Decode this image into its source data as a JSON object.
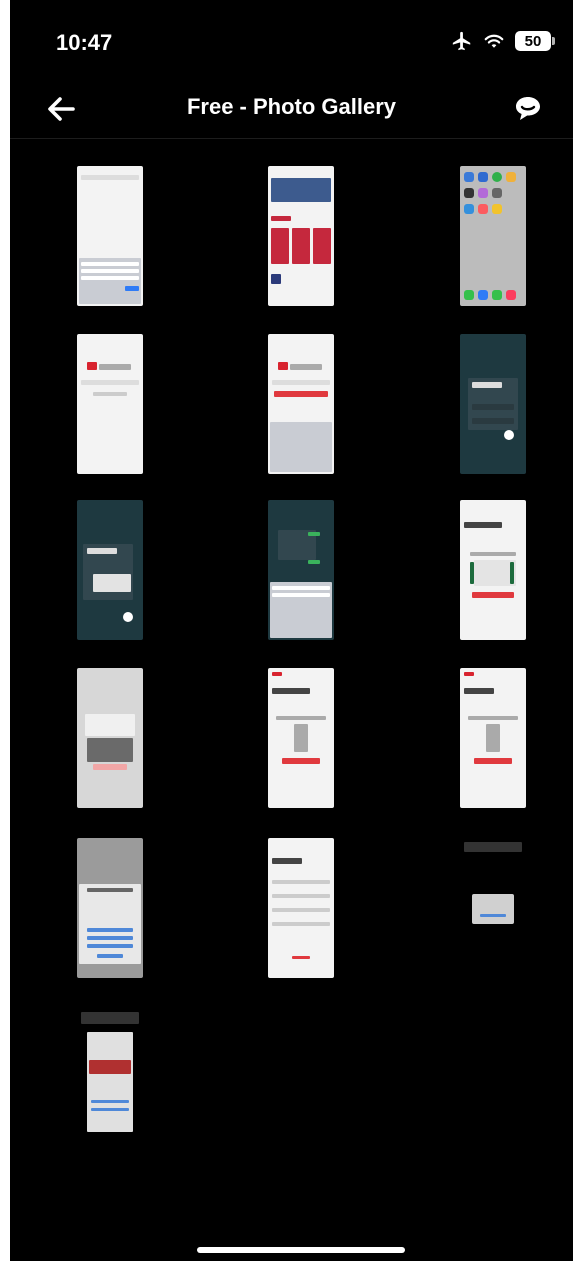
{
  "status_bar": {
    "time": "10:47",
    "battery": "50"
  },
  "nav": {
    "title": "Free - Photo Gallery",
    "back_icon": "arrow-left-icon",
    "action_icon": "chat-bubble-icon"
  },
  "gallery": {
    "thumbnails": [
      {
        "label": "screenshot-1"
      },
      {
        "label": "screenshot-2"
      },
      {
        "label": "screenshot-3"
      },
      {
        "label": "screenshot-4"
      },
      {
        "label": "screenshot-5"
      },
      {
        "label": "screenshot-6"
      },
      {
        "label": "screenshot-7"
      },
      {
        "label": "screenshot-8"
      },
      {
        "label": "screenshot-9"
      },
      {
        "label": "screenshot-10"
      },
      {
        "label": "screenshot-11"
      },
      {
        "label": "screenshot-12"
      },
      {
        "label": "screenshot-13"
      },
      {
        "label": "screenshot-14"
      },
      {
        "label": "screenshot-15"
      },
      {
        "label": "screenshot-16"
      }
    ]
  }
}
